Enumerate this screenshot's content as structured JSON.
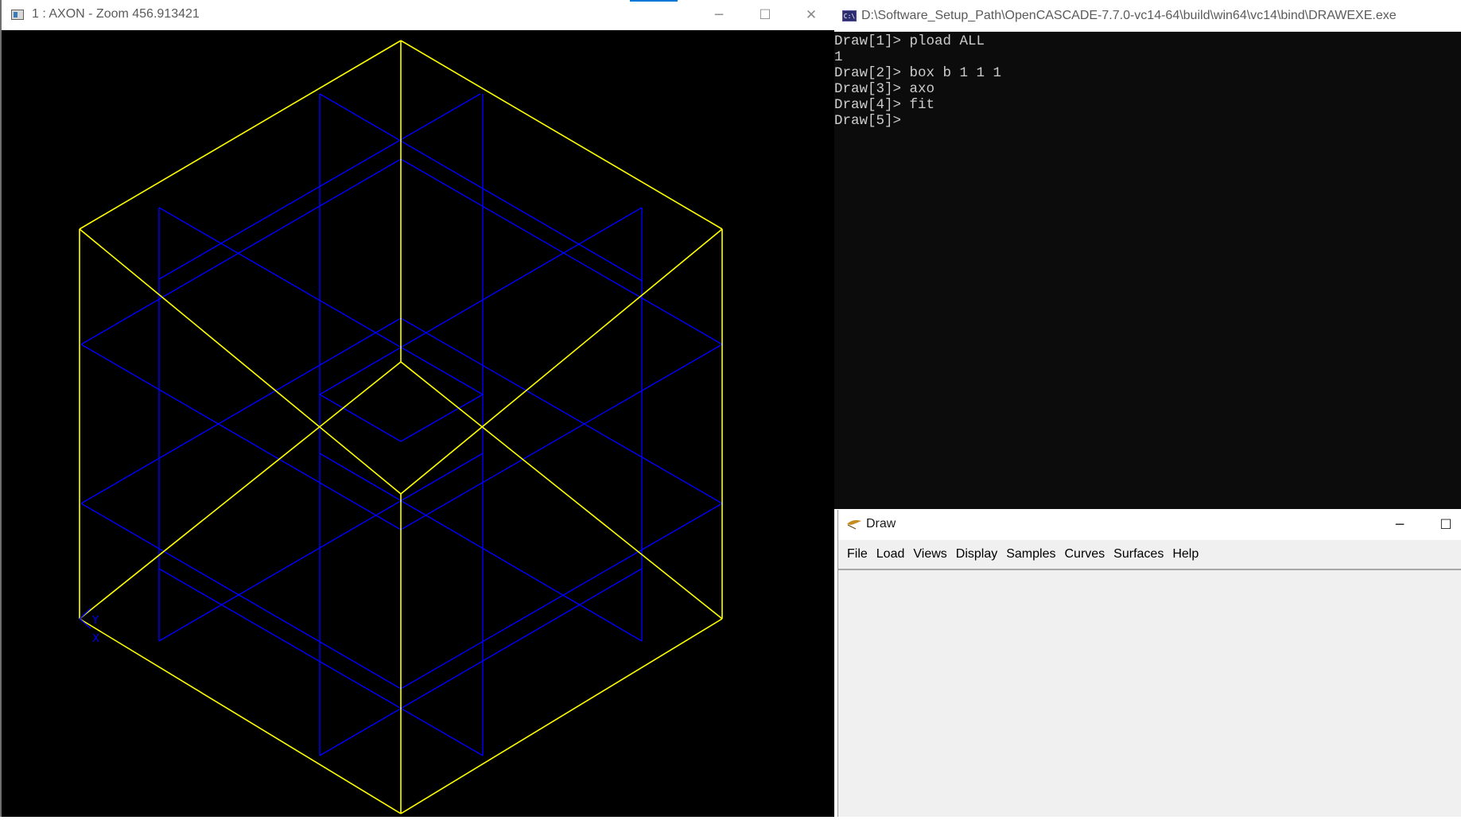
{
  "axon_window": {
    "title": "1 : AXON - Zoom 456.913421",
    "minimize_glyph": "─",
    "maximize_glyph": "☐",
    "close_glyph": "✕",
    "view": {
      "name": "AXON",
      "zoom": "456.913421",
      "edge_colors": {
        "shape_edges": "#ffff00",
        "isoparametric_lines": "#0000ff",
        "axis_trihedron": "#0000ff"
      },
      "axis_labels": {
        "y": "Y",
        "x": "X"
      }
    }
  },
  "console_window": {
    "icon": "C:\\",
    "title": "D:\\Software_Setup_Path\\OpenCASCADE-7.7.0-vc14-64\\build\\win64\\vc14\\bind\\DRAWEXE.exe",
    "lines": [
      "Draw[1]> pload ALL",
      "1",
      "Draw[2]> box b 1 1 1",
      "Draw[3]> axo",
      "Draw[4]> fit",
      "Draw[5]> "
    ]
  },
  "draw_window": {
    "title": "Draw",
    "minimize_glyph": "─",
    "maximize_glyph": "☐",
    "menu": [
      "File",
      "Load",
      "Views",
      "Display",
      "Samples",
      "Curves",
      "Surfaces",
      "Help"
    ]
  }
}
